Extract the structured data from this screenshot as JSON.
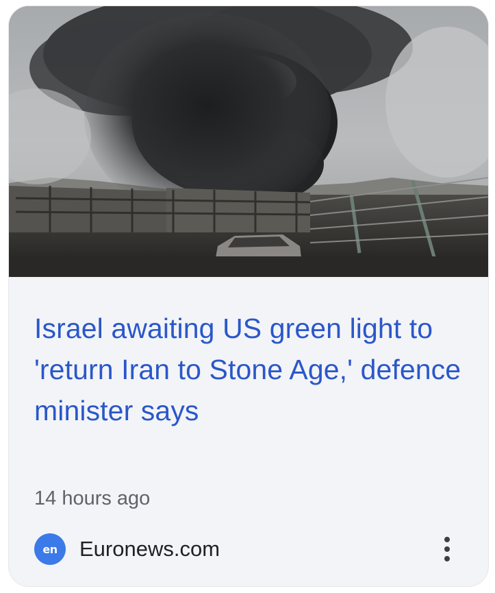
{
  "article": {
    "headline": "Israel awaiting US green light to 'return Iran to Stone Age,' defence minister says",
    "timestamp": "14 hours ago",
    "image_alt": "Black smoke rising over a damaged fenced compound with a burned-out car"
  },
  "source": {
    "logo_text": "en",
    "name": "Euronews.com",
    "logo_color": "#3b7ae8"
  },
  "menu": {
    "icon": "more-vertical-icon"
  },
  "colors": {
    "headline": "#2a57c9",
    "card_background": "#f3f4f7",
    "meta_text": "#5f6368"
  }
}
